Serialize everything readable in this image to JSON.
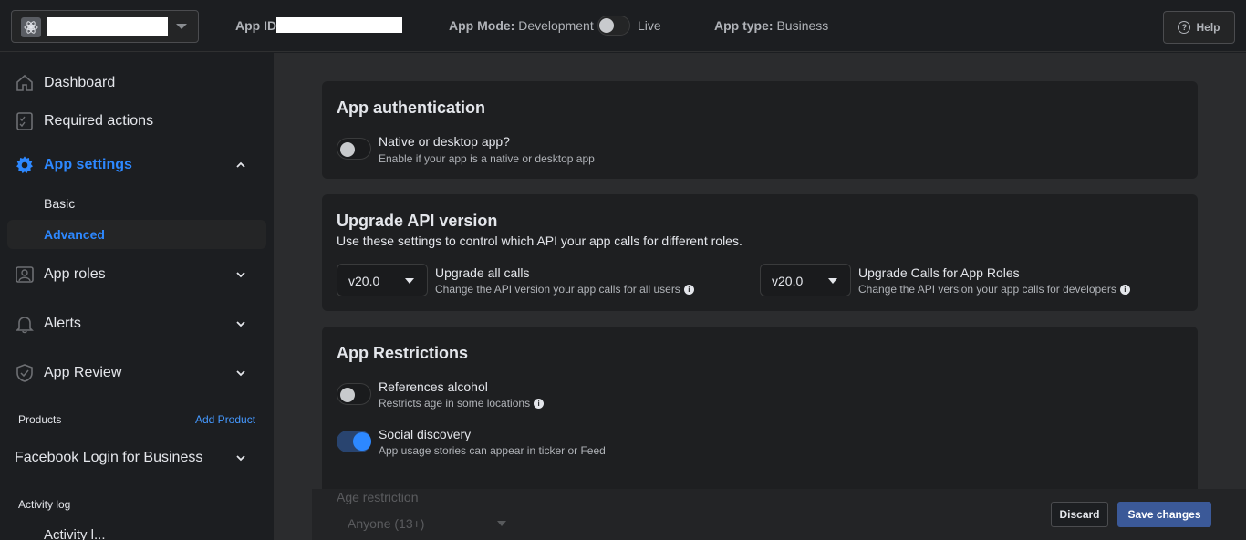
{
  "topbar": {
    "app_id_label": "App ID:",
    "app_mode_label": "App Mode:",
    "app_mode_value": "Development",
    "live_label": "Live",
    "app_type_label": "App type:",
    "app_type_value": "Business",
    "help_label": "Help"
  },
  "sidebar": {
    "dashboard": "Dashboard",
    "required_actions": "Required actions",
    "app_settings": "App settings",
    "basic": "Basic",
    "advanced": "Advanced",
    "app_roles": "App roles",
    "alerts": "Alerts",
    "app_review": "App Review",
    "products": "Products",
    "add_product": "Add Product",
    "facebook_login": "Facebook Login for Business",
    "activity_log": "Activity log",
    "activity_partial": "Activity l..."
  },
  "auth_card": {
    "title": "App authentication",
    "native_label": "Native or desktop app?",
    "native_desc": "Enable if your app is a native or desktop app"
  },
  "api_card": {
    "title": "Upgrade API version",
    "subtitle": "Use these settings to control which API your app calls for different roles.",
    "all_calls_version": "v20.0",
    "all_calls_label": "Upgrade all calls",
    "all_calls_desc": "Change the API version your app calls for all users",
    "roles_version": "v20.0",
    "roles_label": "Upgrade Calls for App Roles",
    "roles_desc": "Change the API version your app calls for developers"
  },
  "restrictions_card": {
    "title": "App Restrictions",
    "alcohol_label": "References alcohol",
    "alcohol_desc": "Restricts age in some locations",
    "social_label": "Social discovery",
    "social_desc": "App usage stories can appear in ticker or Feed",
    "age_label": "Age restriction",
    "age_value": "Anyone (13+)"
  },
  "actions": {
    "discard": "Discard",
    "save": "Save changes"
  },
  "colors": {
    "accent": "#2d88ff",
    "save_button": "#3b5998"
  }
}
